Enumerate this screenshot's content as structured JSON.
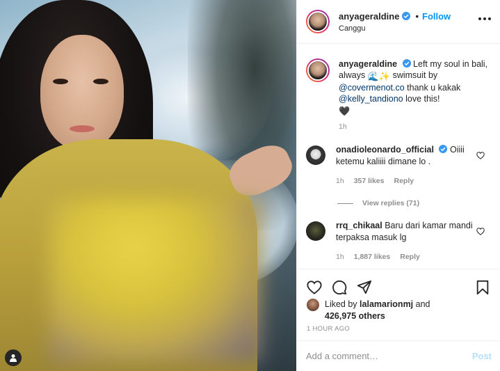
{
  "post": {
    "username": "anyageraldine",
    "follow_label": "Follow",
    "dot": "•",
    "location": "Canggu"
  },
  "caption": {
    "username": "anyageraldine",
    "text_1": "Left my soul in bali, always",
    "emoji": "🌊✨",
    "text_2": "swimsuit by",
    "mention_1": "@covermenot.co",
    "text_3": "thank u kakak",
    "mention_2": "@kelly_tandiono",
    "text_4": "love this!",
    "emoji_end": "🖤",
    "time": "1h"
  },
  "comments": [
    {
      "username": "onadioleonardo_official",
      "text": "Oiiii ketemu kaliiii dimane lo .",
      "time": "1h",
      "likes": "357 likes",
      "reply_label": "Reply",
      "verified": true
    },
    {
      "username": "rrq_chikaal",
      "text": "Baru dari kamar mandi terpaksa masuk lg",
      "time": "1h",
      "likes": "1,887 likes",
      "reply_label": "Reply",
      "verified": false
    }
  ],
  "view_replies": "View replies (71)",
  "likes": {
    "prefix": "Liked by",
    "user": "lalamarionmj",
    "and": "and",
    "count": "426,975 others"
  },
  "timestamp": "1 HOUR AGO",
  "comment_box": {
    "placeholder": "Add a comment…",
    "post_label": "Post"
  },
  "colors": {
    "accent": "#0095f6",
    "verified": "#3897f0",
    "muted": "#8e8e8e"
  }
}
